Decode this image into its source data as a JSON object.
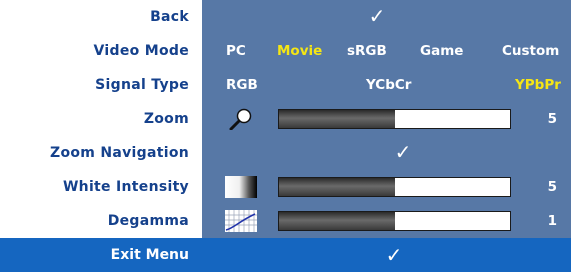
{
  "menu": {
    "rows": [
      {
        "label": "Back"
      },
      {
        "label": "Video Mode",
        "options": [
          "PC",
          "Movie",
          "sRGB",
          "Game",
          "Custom"
        ],
        "selected": "Movie"
      },
      {
        "label": "Signal Type",
        "options": [
          "RGB",
          "YCbCr",
          "YPbPr"
        ],
        "selected": "YPbPr"
      },
      {
        "label": "Zoom",
        "icon": "magnifier-icon",
        "level": 0.5,
        "value": "5"
      },
      {
        "label": "Zoom Navigation"
      },
      {
        "label": "White Intensity",
        "icon": "white-intensity-icon",
        "level": 0.5,
        "value": "5"
      },
      {
        "label": "Degamma",
        "icon": "degamma-graph-icon",
        "level": 0.5,
        "value": "1"
      }
    ],
    "check_glyph": "✓",
    "exit_label": "Exit Menu"
  },
  "colors": {
    "label_text": "#15418c",
    "panel_bg": "#5778a6",
    "selected_text": "#f5e614",
    "exit_bg": "#1566c0"
  }
}
